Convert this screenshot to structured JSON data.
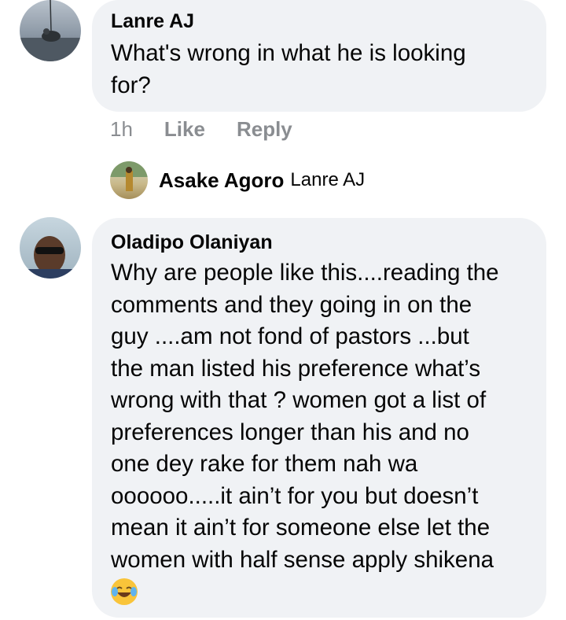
{
  "comments": [
    {
      "author": "Lanre AJ",
      "text": "What's wrong in what he is looking for?",
      "lines": [
        "What's wrong in what he is looking",
        "for?"
      ],
      "time": "1h",
      "like_label": "Like",
      "reply_label": "Reply"
    },
    {
      "author": "Oladipo Olaniyan",
      "lines": [
        "Why are people like this....reading the",
        "comments and they going in on the",
        "guy ....am not fond of pastors ...but",
        "the man listed his preference what’s",
        "wrong with that ? women got a list of",
        "preferences longer than his and no",
        "one dey rake for them nah wa",
        "oooooo.....it ain’t for you but doesn’t",
        "mean it ain’t for someone else let the",
        "women with half sense apply shikena"
      ],
      "emoji": "tears-of-joy-emoji"
    }
  ],
  "reply_preview": {
    "author": "Asake Agoro",
    "mention": "Lanre AJ"
  },
  "colors": {
    "bubble": "#f0f2f5",
    "meta": "#8a8d91",
    "text": "#050505"
  }
}
